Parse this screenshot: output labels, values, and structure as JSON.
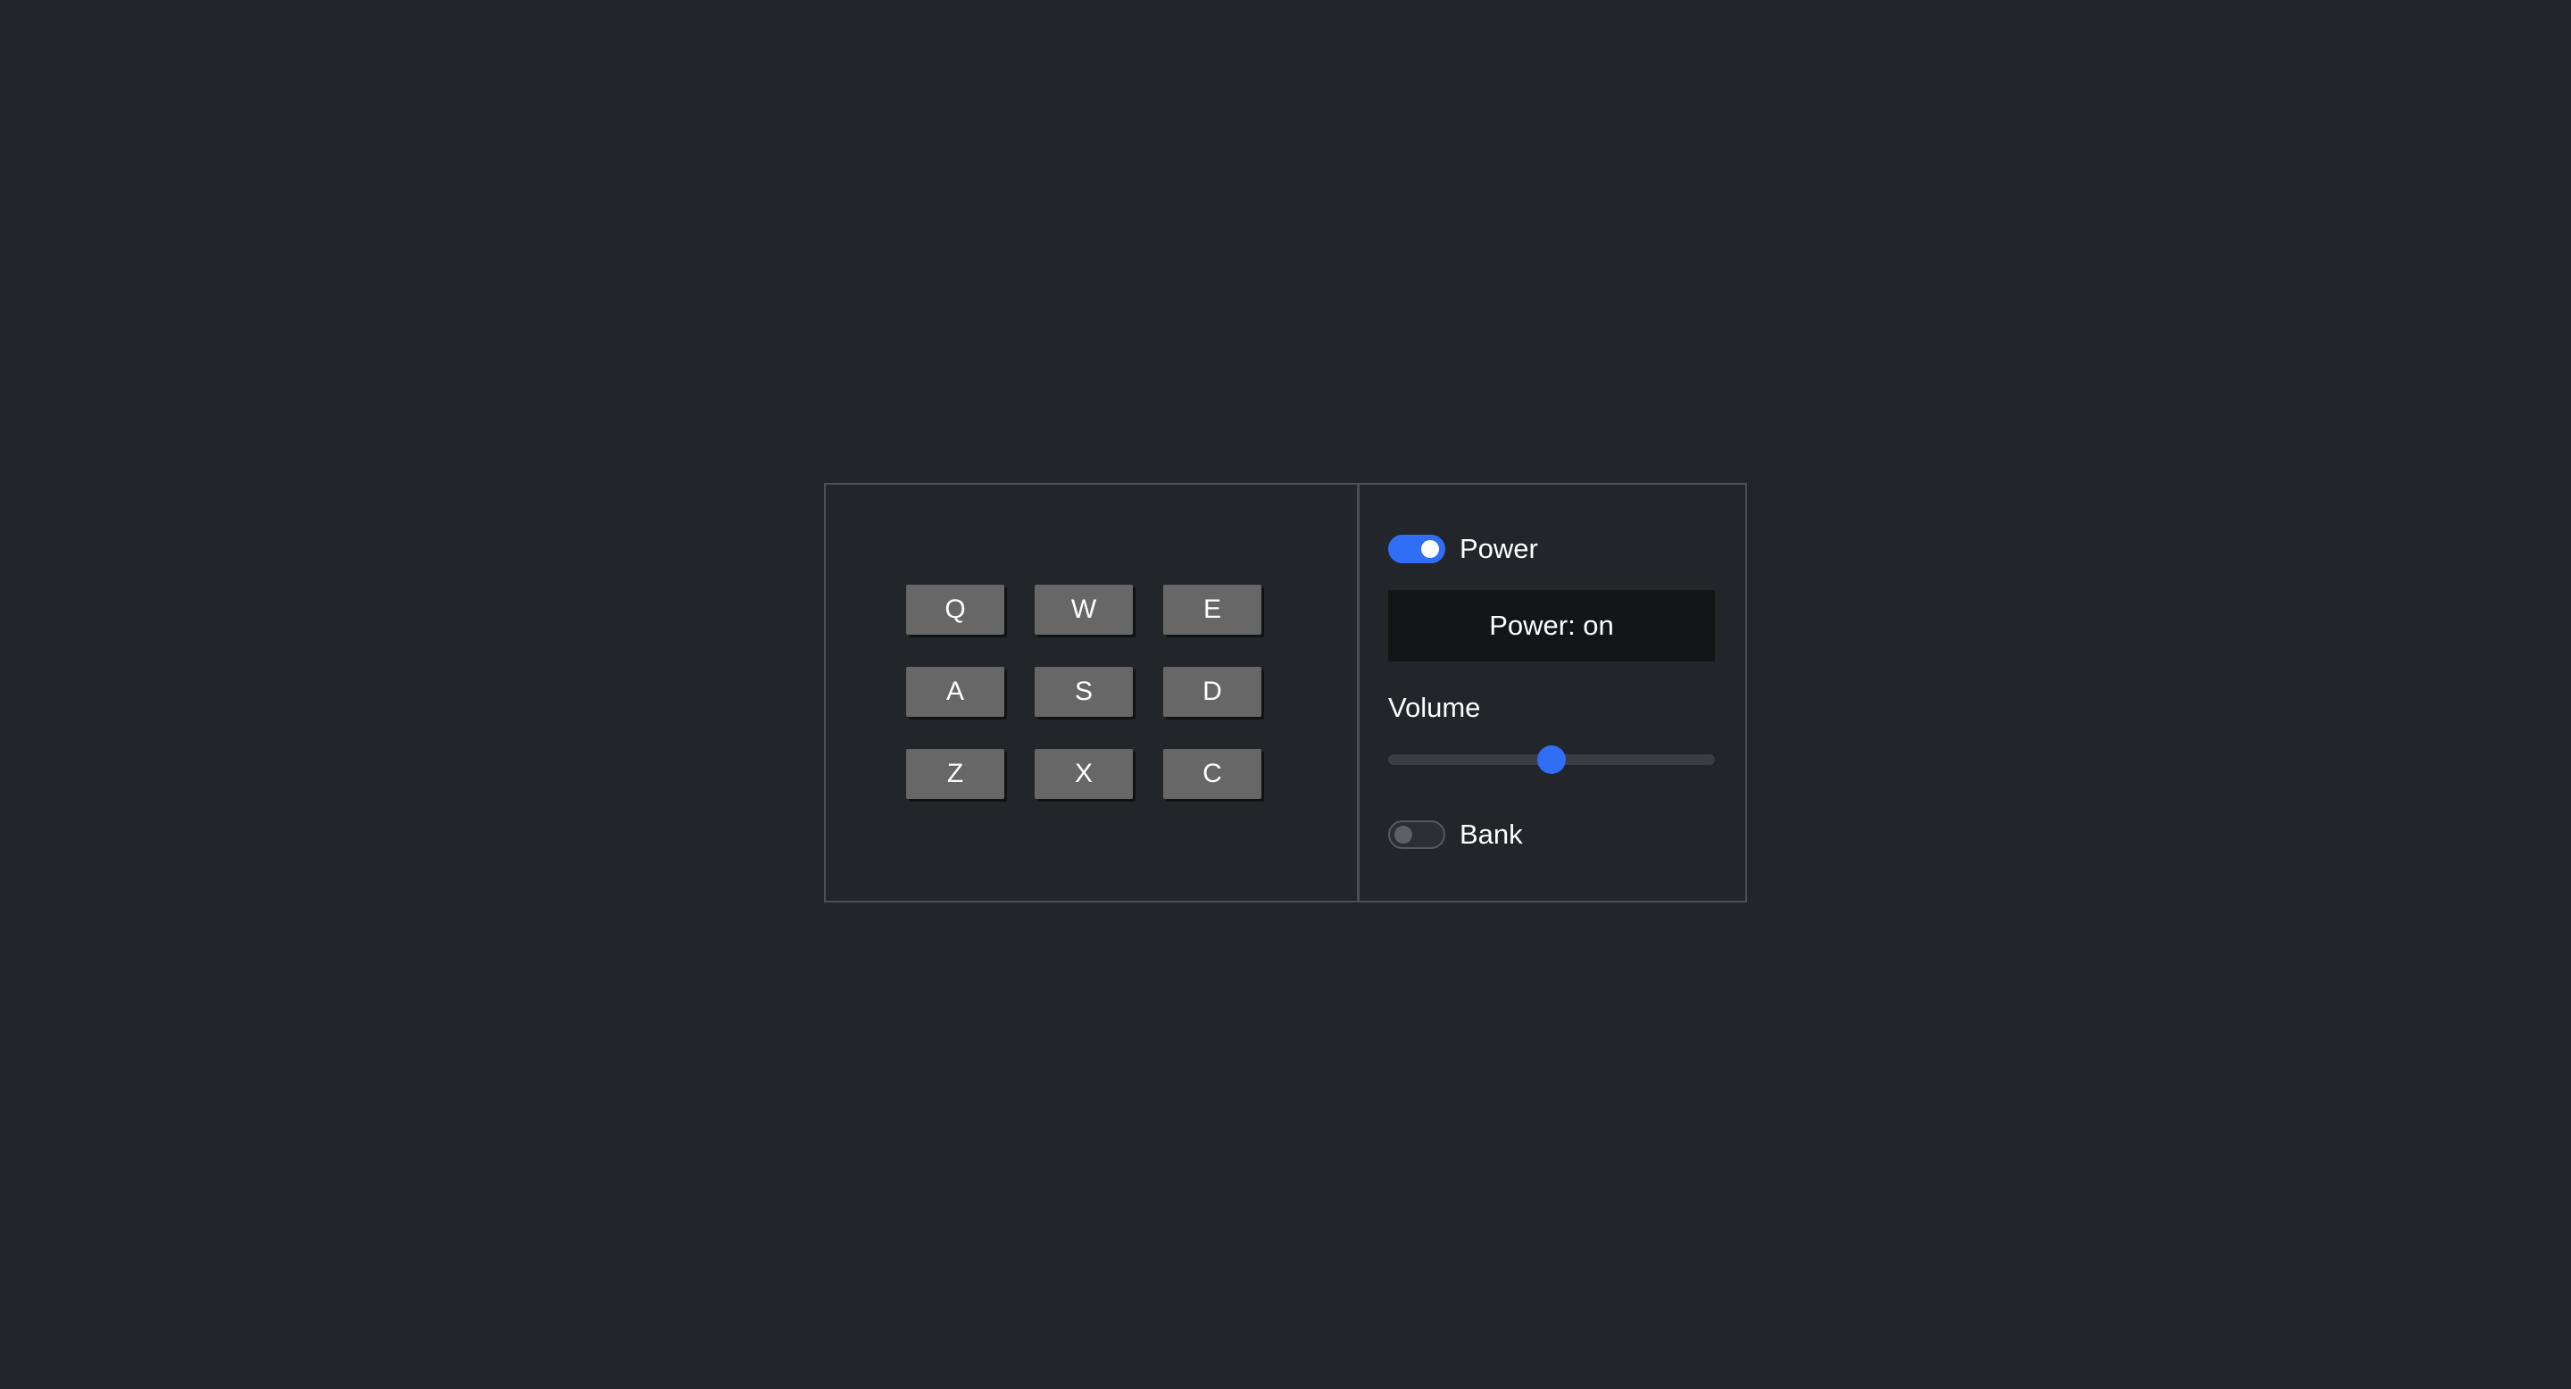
{
  "pads": [
    "Q",
    "W",
    "E",
    "A",
    "S",
    "D",
    "Z",
    "X",
    "C"
  ],
  "power": {
    "label": "Power",
    "on": true
  },
  "display": {
    "text": "Power: on"
  },
  "volume": {
    "label": "Volume",
    "value": 0.5
  },
  "bank": {
    "label": "Bank",
    "on": false
  },
  "colors": {
    "background": "#222529",
    "accent": "#2f6ef5",
    "pad": "#676767",
    "display": "#141517",
    "border": "#4c4f54"
  }
}
